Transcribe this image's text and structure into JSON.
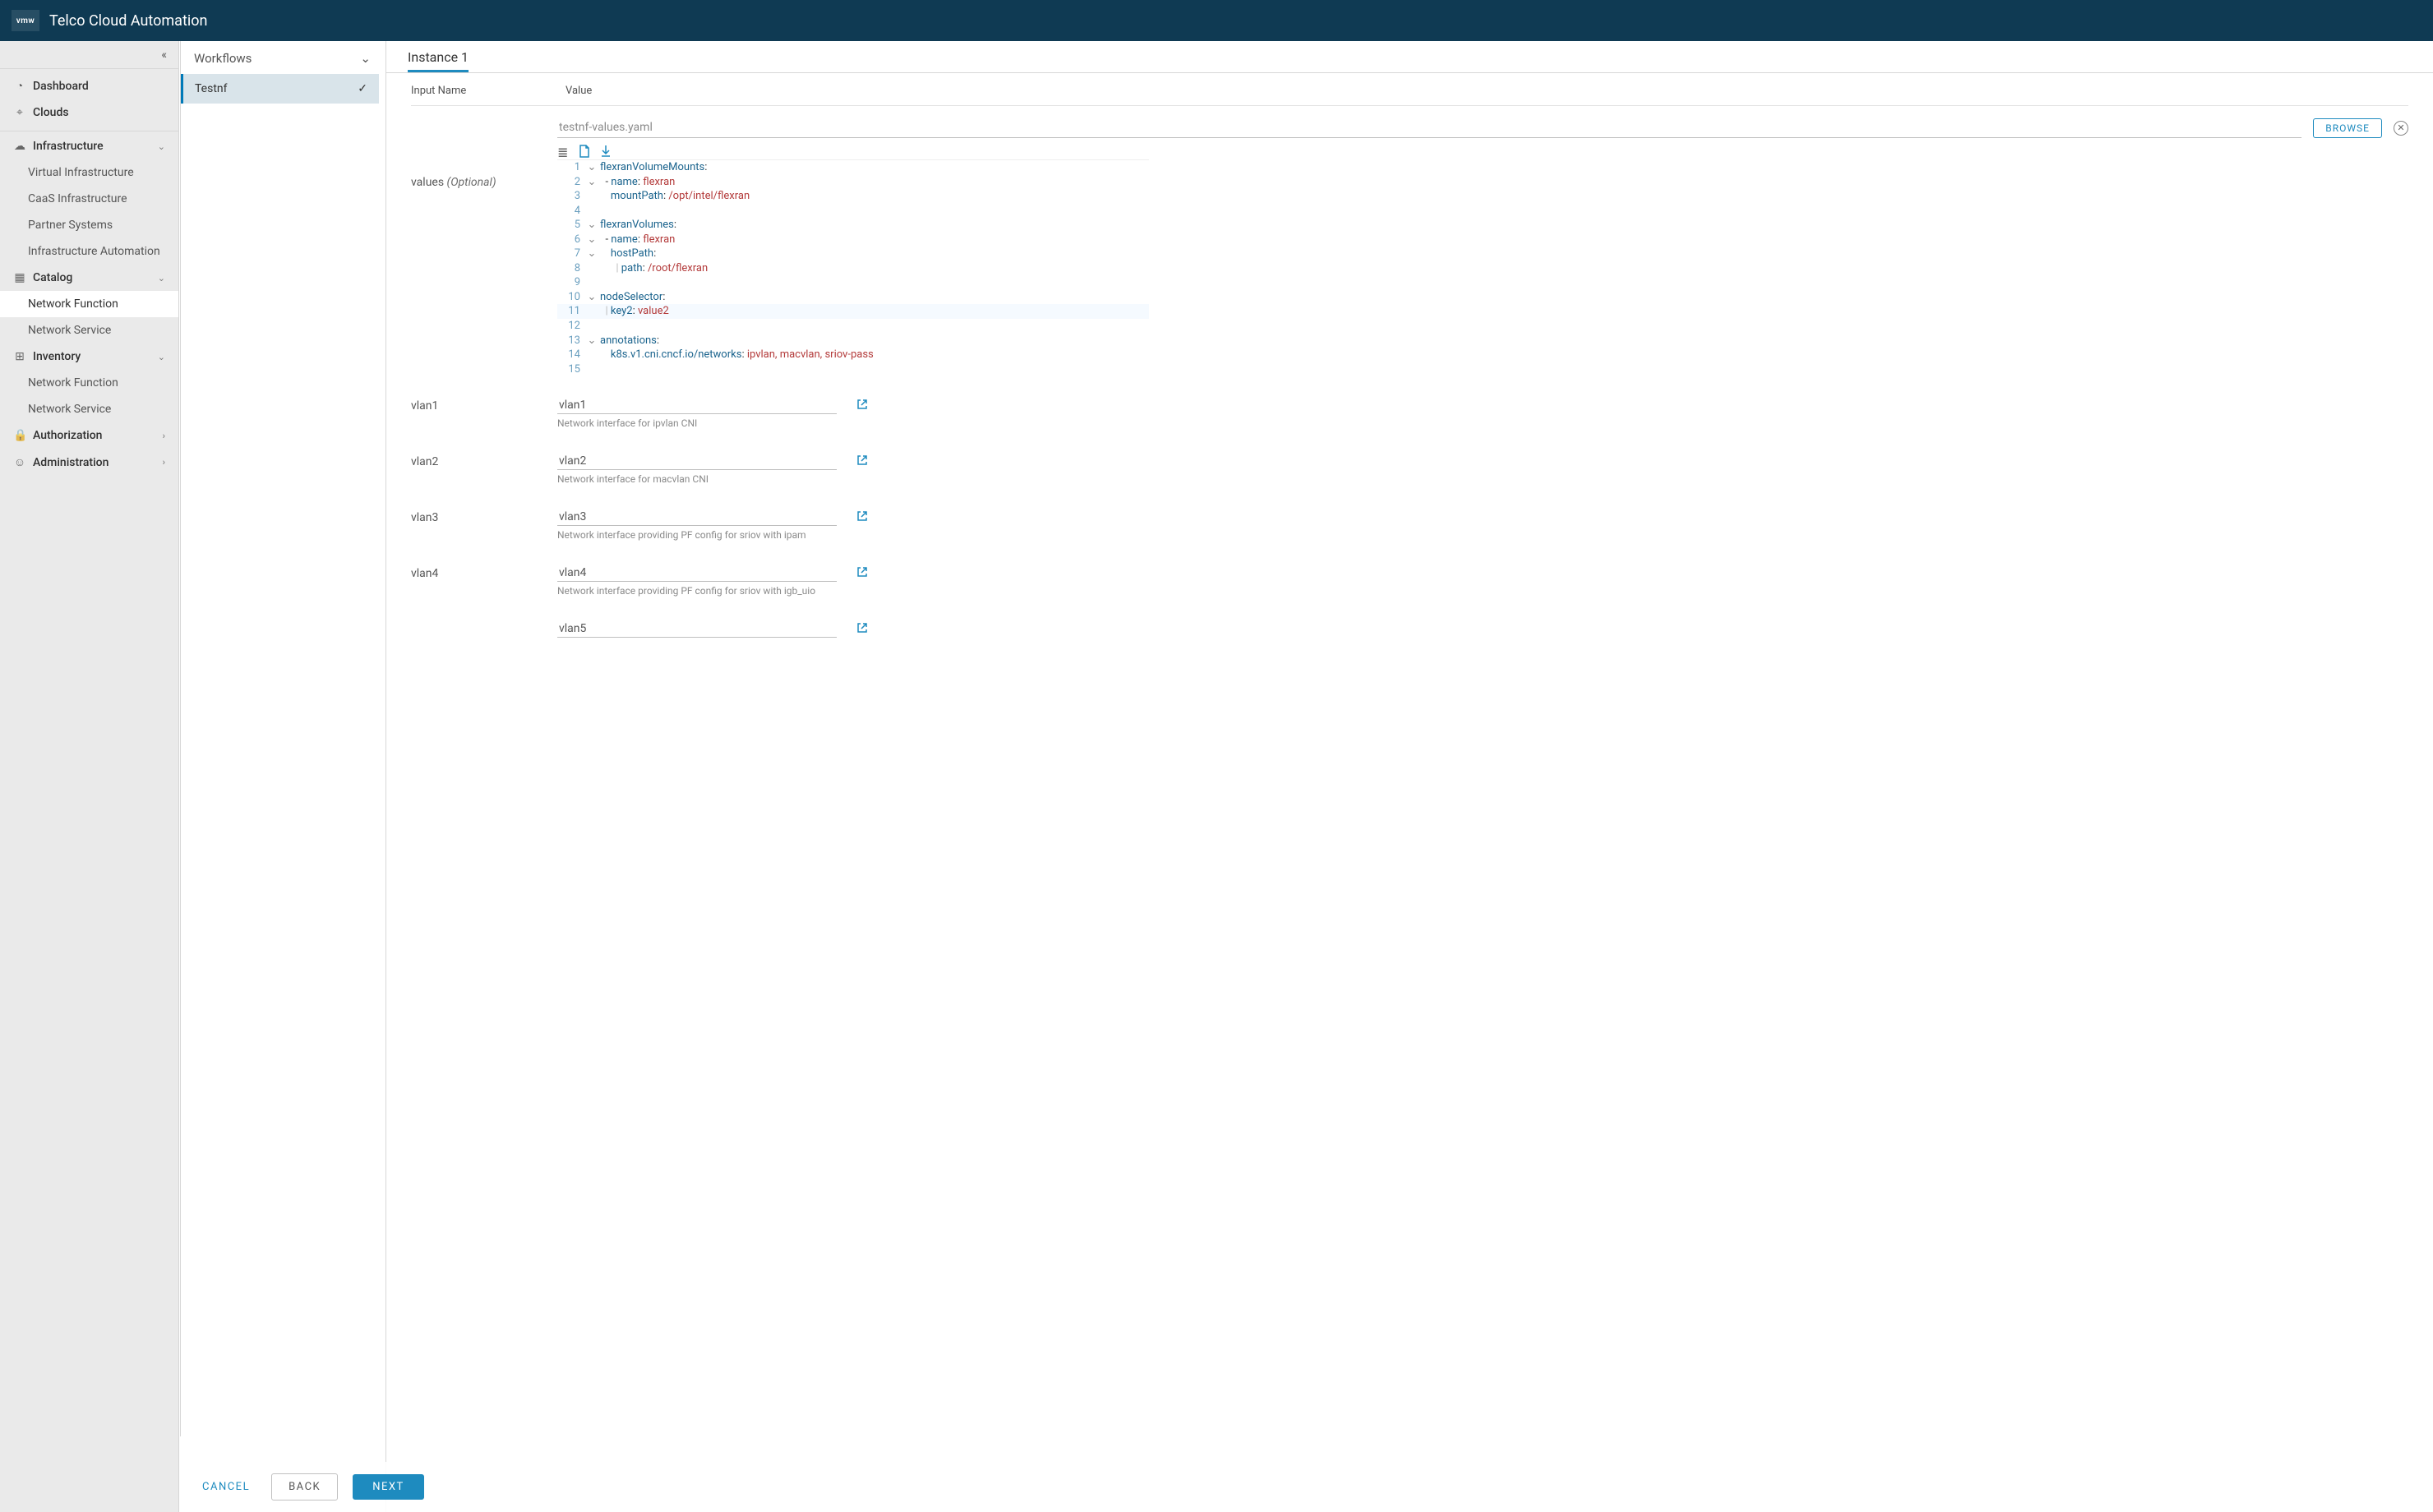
{
  "header": {
    "logo": "vmw",
    "title": "Telco Cloud Automation"
  },
  "sidebar": {
    "top": [
      {
        "icon": "tachometer-icon",
        "label": "Dashboard"
      },
      {
        "icon": "pin-icon",
        "label": "Clouds"
      }
    ],
    "infrastructure": {
      "label": "Infrastructure",
      "children": [
        {
          "label": "Virtual Infrastructure"
        },
        {
          "label": "CaaS Infrastructure"
        },
        {
          "label": "Partner Systems"
        },
        {
          "label": "Infrastructure Automation"
        }
      ]
    },
    "catalog": {
      "label": "Catalog",
      "children": [
        {
          "label": "Network Function",
          "selected": true
        },
        {
          "label": "Network Service"
        }
      ]
    },
    "inventory": {
      "label": "Inventory",
      "children": [
        {
          "label": "Network Function"
        },
        {
          "label": "Network Service"
        }
      ]
    },
    "authorization": {
      "label": "Authorization"
    },
    "administration": {
      "label": "Administration"
    }
  },
  "workflows": {
    "header": "Workflows",
    "item": "Testnf"
  },
  "tab": {
    "label": "Instance 1"
  },
  "columns": {
    "name": "Input Name",
    "value": "Value"
  },
  "file": {
    "name": "testnf-values.yaml",
    "browse": "BROWSE"
  },
  "values": {
    "label": "values ",
    "optional": "(Optional)"
  },
  "editor": {
    "lines": [
      {
        "n": 1,
        "fold": true,
        "indent": 0,
        "key": "flexranVolumeMounts",
        "colon": ":"
      },
      {
        "n": 2,
        "fold": true,
        "indent": 1,
        "dash": true,
        "key": "name",
        "colon": ": ",
        "val": "flexran"
      },
      {
        "n": 3,
        "fold": false,
        "indent": 2,
        "key": "mountPath",
        "colon": ": ",
        "val": "/opt/intel/flexran"
      },
      {
        "n": 4,
        "fold": false,
        "indent": 0,
        "blank": true
      },
      {
        "n": 5,
        "fold": true,
        "indent": 0,
        "key": "flexranVolumes",
        "colon": ":"
      },
      {
        "n": 6,
        "fold": true,
        "indent": 1,
        "dash": true,
        "key": "name",
        "colon": ": ",
        "val": "flexran"
      },
      {
        "n": 7,
        "fold": true,
        "indent": 2,
        "key": "hostPath",
        "colon": ":"
      },
      {
        "n": 8,
        "fold": false,
        "indent": 3,
        "bar": true,
        "key": "path",
        "colon": ": ",
        "val": "/root/flexran"
      },
      {
        "n": 9,
        "fold": false,
        "indent": 0,
        "blank": true
      },
      {
        "n": 10,
        "fold": true,
        "indent": 0,
        "key": "nodeSelector",
        "colon": ":"
      },
      {
        "n": 11,
        "fold": false,
        "indent": 1,
        "bar": true,
        "selected": true,
        "key": "key2",
        "colon": ": ",
        "val": "value2"
      },
      {
        "n": 12,
        "fold": false,
        "indent": 0,
        "blank": true
      },
      {
        "n": 13,
        "fold": true,
        "indent": 0,
        "key": "annotations",
        "colon": ":"
      },
      {
        "n": 14,
        "fold": false,
        "indent": 2,
        "key": "k8s.v1.cni.cncf.io/networks",
        "colon": ": ",
        "val": "ipvlan, macvlan, sriov-pass"
      },
      {
        "n": 15,
        "fold": false,
        "indent": 0,
        "blank": true
      }
    ]
  },
  "vlans": [
    {
      "label": "vlan1",
      "value": "vlan1",
      "hint": "Network interface for ipvlan CNI"
    },
    {
      "label": "vlan2",
      "value": "vlan2",
      "hint": "Network interface for macvlan CNI"
    },
    {
      "label": "vlan3",
      "value": "vlan3",
      "hint": "Network interface providing PF config for sriov with ipam"
    },
    {
      "label": "vlan4",
      "value": "vlan4",
      "hint": "Network interface providing PF config for sriov with igb_uio"
    },
    {
      "label": "",
      "value": "vlan5",
      "hint": ""
    }
  ],
  "footer": {
    "cancel": "CANCEL",
    "back": "BACK",
    "next": "NEXT"
  }
}
